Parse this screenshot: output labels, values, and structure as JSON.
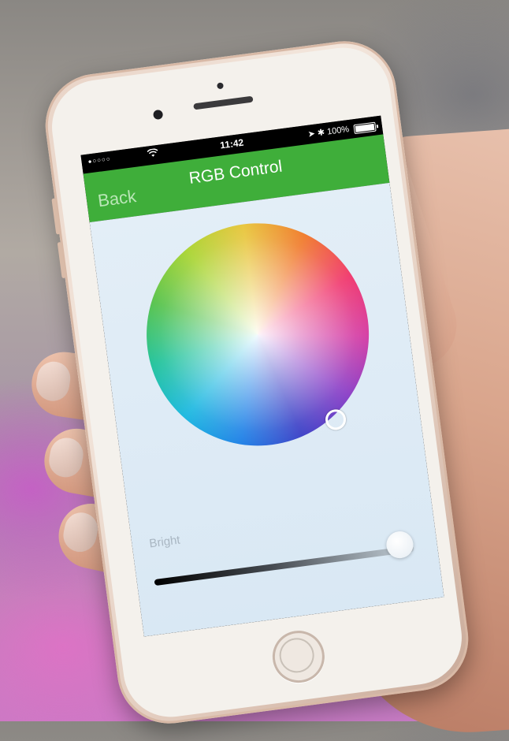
{
  "status_bar": {
    "carrier_signal": "●○○○○",
    "time": "11:42",
    "right_text": "➤ ✱ 100%",
    "wifi_icon": "wifi-icon"
  },
  "nav": {
    "back_label": "Back",
    "title": "RGB Control"
  },
  "color_wheel": {
    "selected_hue_region": "blue-violet"
  },
  "brightness": {
    "label": "Bright",
    "value_fraction": 0.95
  },
  "colors": {
    "nav_bar": "#3fae3a",
    "content_bg": "#e3eef7"
  }
}
